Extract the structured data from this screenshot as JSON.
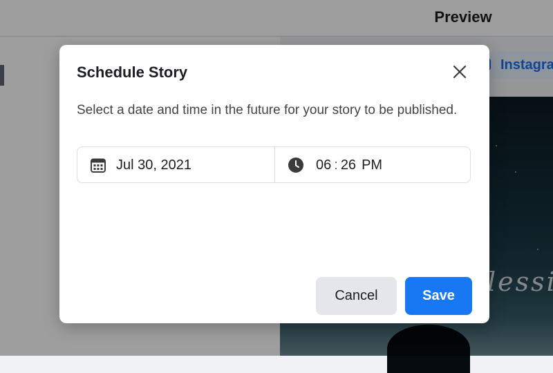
{
  "background": {
    "preview_title": "Preview",
    "platform_tab_label": "Instagra",
    "story_text": "lessin"
  },
  "dialog": {
    "title": "Schedule Story",
    "description": "Select a date and time in the future for your story to be published.",
    "date_value": "Jul 30, 2021",
    "time_hour": "06",
    "time_separator": ":",
    "time_minute": "26",
    "time_ampm": "PM",
    "cancel_label": "Cancel",
    "save_label": "Save"
  },
  "icons": {
    "close": "close-icon",
    "calendar": "calendar-icon",
    "clock": "clock-icon"
  },
  "colors": {
    "primary": "#1877f2",
    "secondary_button": "#e4e6eb",
    "text": "#1c1e21",
    "link_blue": "#1b6ef0"
  }
}
